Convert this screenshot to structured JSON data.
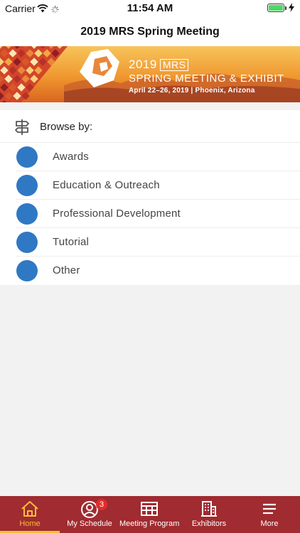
{
  "status_bar": {
    "carrier": "Carrier",
    "time": "11:54 AM",
    "battery_level": 1.0
  },
  "nav": {
    "title": "2019 MRS Spring Meeting"
  },
  "banner": {
    "year": "2019",
    "org": "MRS",
    "title": "SPRING MEETING & EXHIBIT",
    "dates": "April 22–26, 2019 | Phoenix, Arizona",
    "colors": {
      "sky": "#f2a33a",
      "accent": "#c8262c"
    }
  },
  "browse": {
    "header": "Browse by:",
    "items": [
      {
        "label": "Awards",
        "color": "#2f78c4"
      },
      {
        "label": "Education & Outreach",
        "color": "#2f78c4"
      },
      {
        "label": "Professional Development",
        "color": "#2f78c4"
      },
      {
        "label": "Tutorial",
        "color": "#2f78c4"
      },
      {
        "label": "Other",
        "color": "#2f78c4"
      }
    ]
  },
  "tab_bar": {
    "background": "#a02b30",
    "active_color": "#f6be3a",
    "tabs": [
      {
        "label": "Home",
        "icon": "home-icon",
        "active": true
      },
      {
        "label": "My Schedule",
        "icon": "user-circle-icon",
        "badge": "3"
      },
      {
        "label": "Meeting Program",
        "icon": "calendar-grid-icon"
      },
      {
        "label": "Exhibitors",
        "icon": "building-icon"
      },
      {
        "label": "More",
        "icon": "hamburger-icon"
      }
    ]
  }
}
